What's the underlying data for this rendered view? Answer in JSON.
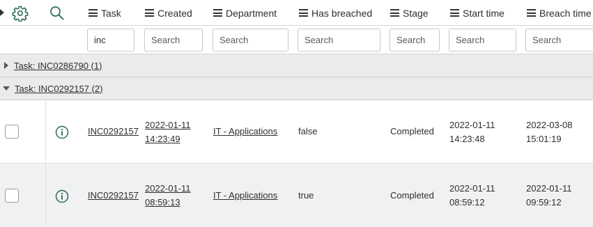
{
  "header": {
    "columns": [
      {
        "label": "Task"
      },
      {
        "label": "Created"
      },
      {
        "label": "Department"
      },
      {
        "label": "Has breached"
      },
      {
        "label": "Stage"
      },
      {
        "label": "Start time"
      },
      {
        "label": "Breach time"
      }
    ]
  },
  "filters": {
    "task_value": "inc",
    "placeholder": "Search"
  },
  "groups": [
    {
      "label": "Task: INC0286790 (1)",
      "expanded": false
    },
    {
      "label": "Task: INC0292157 (2)",
      "expanded": true
    }
  ],
  "rows": [
    {
      "task": "INC0292157",
      "created_date": "2022-01-11",
      "created_time": "14:23:49",
      "department": "IT - Applications",
      "has_breached": "false",
      "stage": "Completed",
      "start_date": "2022-01-11",
      "start_time": "14:23:48",
      "breach_date": "2022-03-08",
      "breach_time": "15:01:19"
    },
    {
      "task": "INC0292157",
      "created_date": "2022-01-11",
      "created_time": "08:59:13",
      "department": "IT - Applications",
      "has_breached": "true",
      "stage": "Completed",
      "start_date": "2022-01-11",
      "start_time": "08:59:12",
      "breach_date": "2022-01-11",
      "breach_time": "09:59:12"
    }
  ],
  "colors": {
    "group_bg": "#e9ebec",
    "row_alt_bg": "#f0f1f2",
    "icon_teal": "#2b6b5b"
  }
}
